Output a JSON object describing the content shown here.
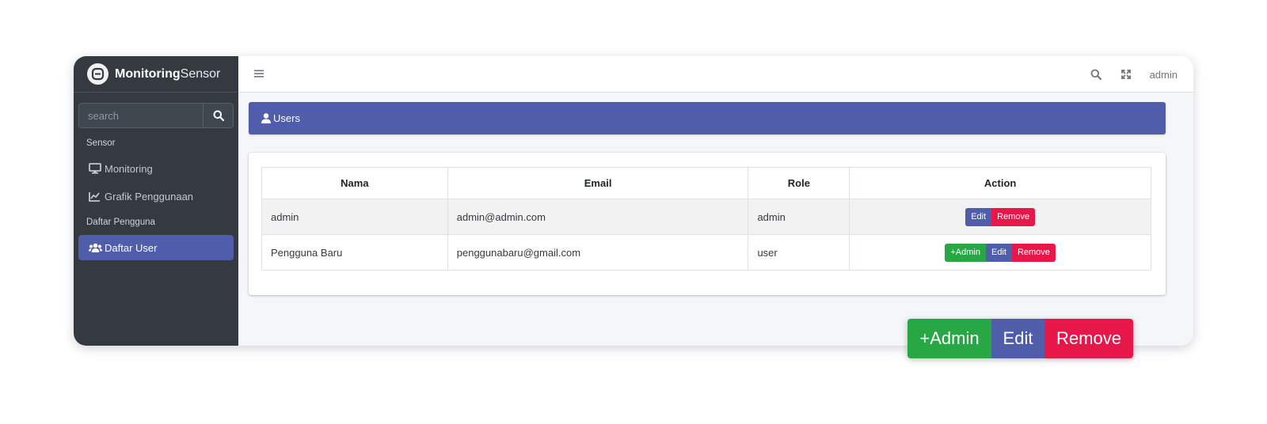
{
  "brand": {
    "name_bold": "Monitoring",
    "name_light": "Sensor"
  },
  "sidebar": {
    "search_placeholder": "search",
    "sections": [
      {
        "header": "Sensor",
        "items": [
          {
            "label": "Monitoring",
            "icon": "desktop-icon"
          },
          {
            "label": "Grafik Penggunaan",
            "icon": "chart-line-icon"
          }
        ]
      },
      {
        "header": "Daftar Pengguna",
        "items": [
          {
            "label": "Daftar User",
            "icon": "users-icon",
            "active": true
          }
        ]
      }
    ]
  },
  "topbar": {
    "user": "admin"
  },
  "page": {
    "title": "Users"
  },
  "table": {
    "headers": [
      "Nama",
      "Email",
      "Role",
      "Action"
    ],
    "rows": [
      {
        "nama": "admin",
        "email": "admin@admin.com",
        "role": "admin",
        "actions": [
          "Edit",
          "Remove"
        ]
      },
      {
        "nama": "Pengguna Baru",
        "email": "penggunabaru@gmail.com",
        "role": "user",
        "actions": [
          "+Admin",
          "Edit",
          "Remove"
        ]
      }
    ]
  },
  "callout": {
    "buttons": [
      "+Admin",
      "Edit",
      "Remove"
    ]
  },
  "colors": {
    "sidebar": "#343a40",
    "accent": "#4f5dab",
    "success": "#28a745",
    "danger": "#e8174a"
  }
}
